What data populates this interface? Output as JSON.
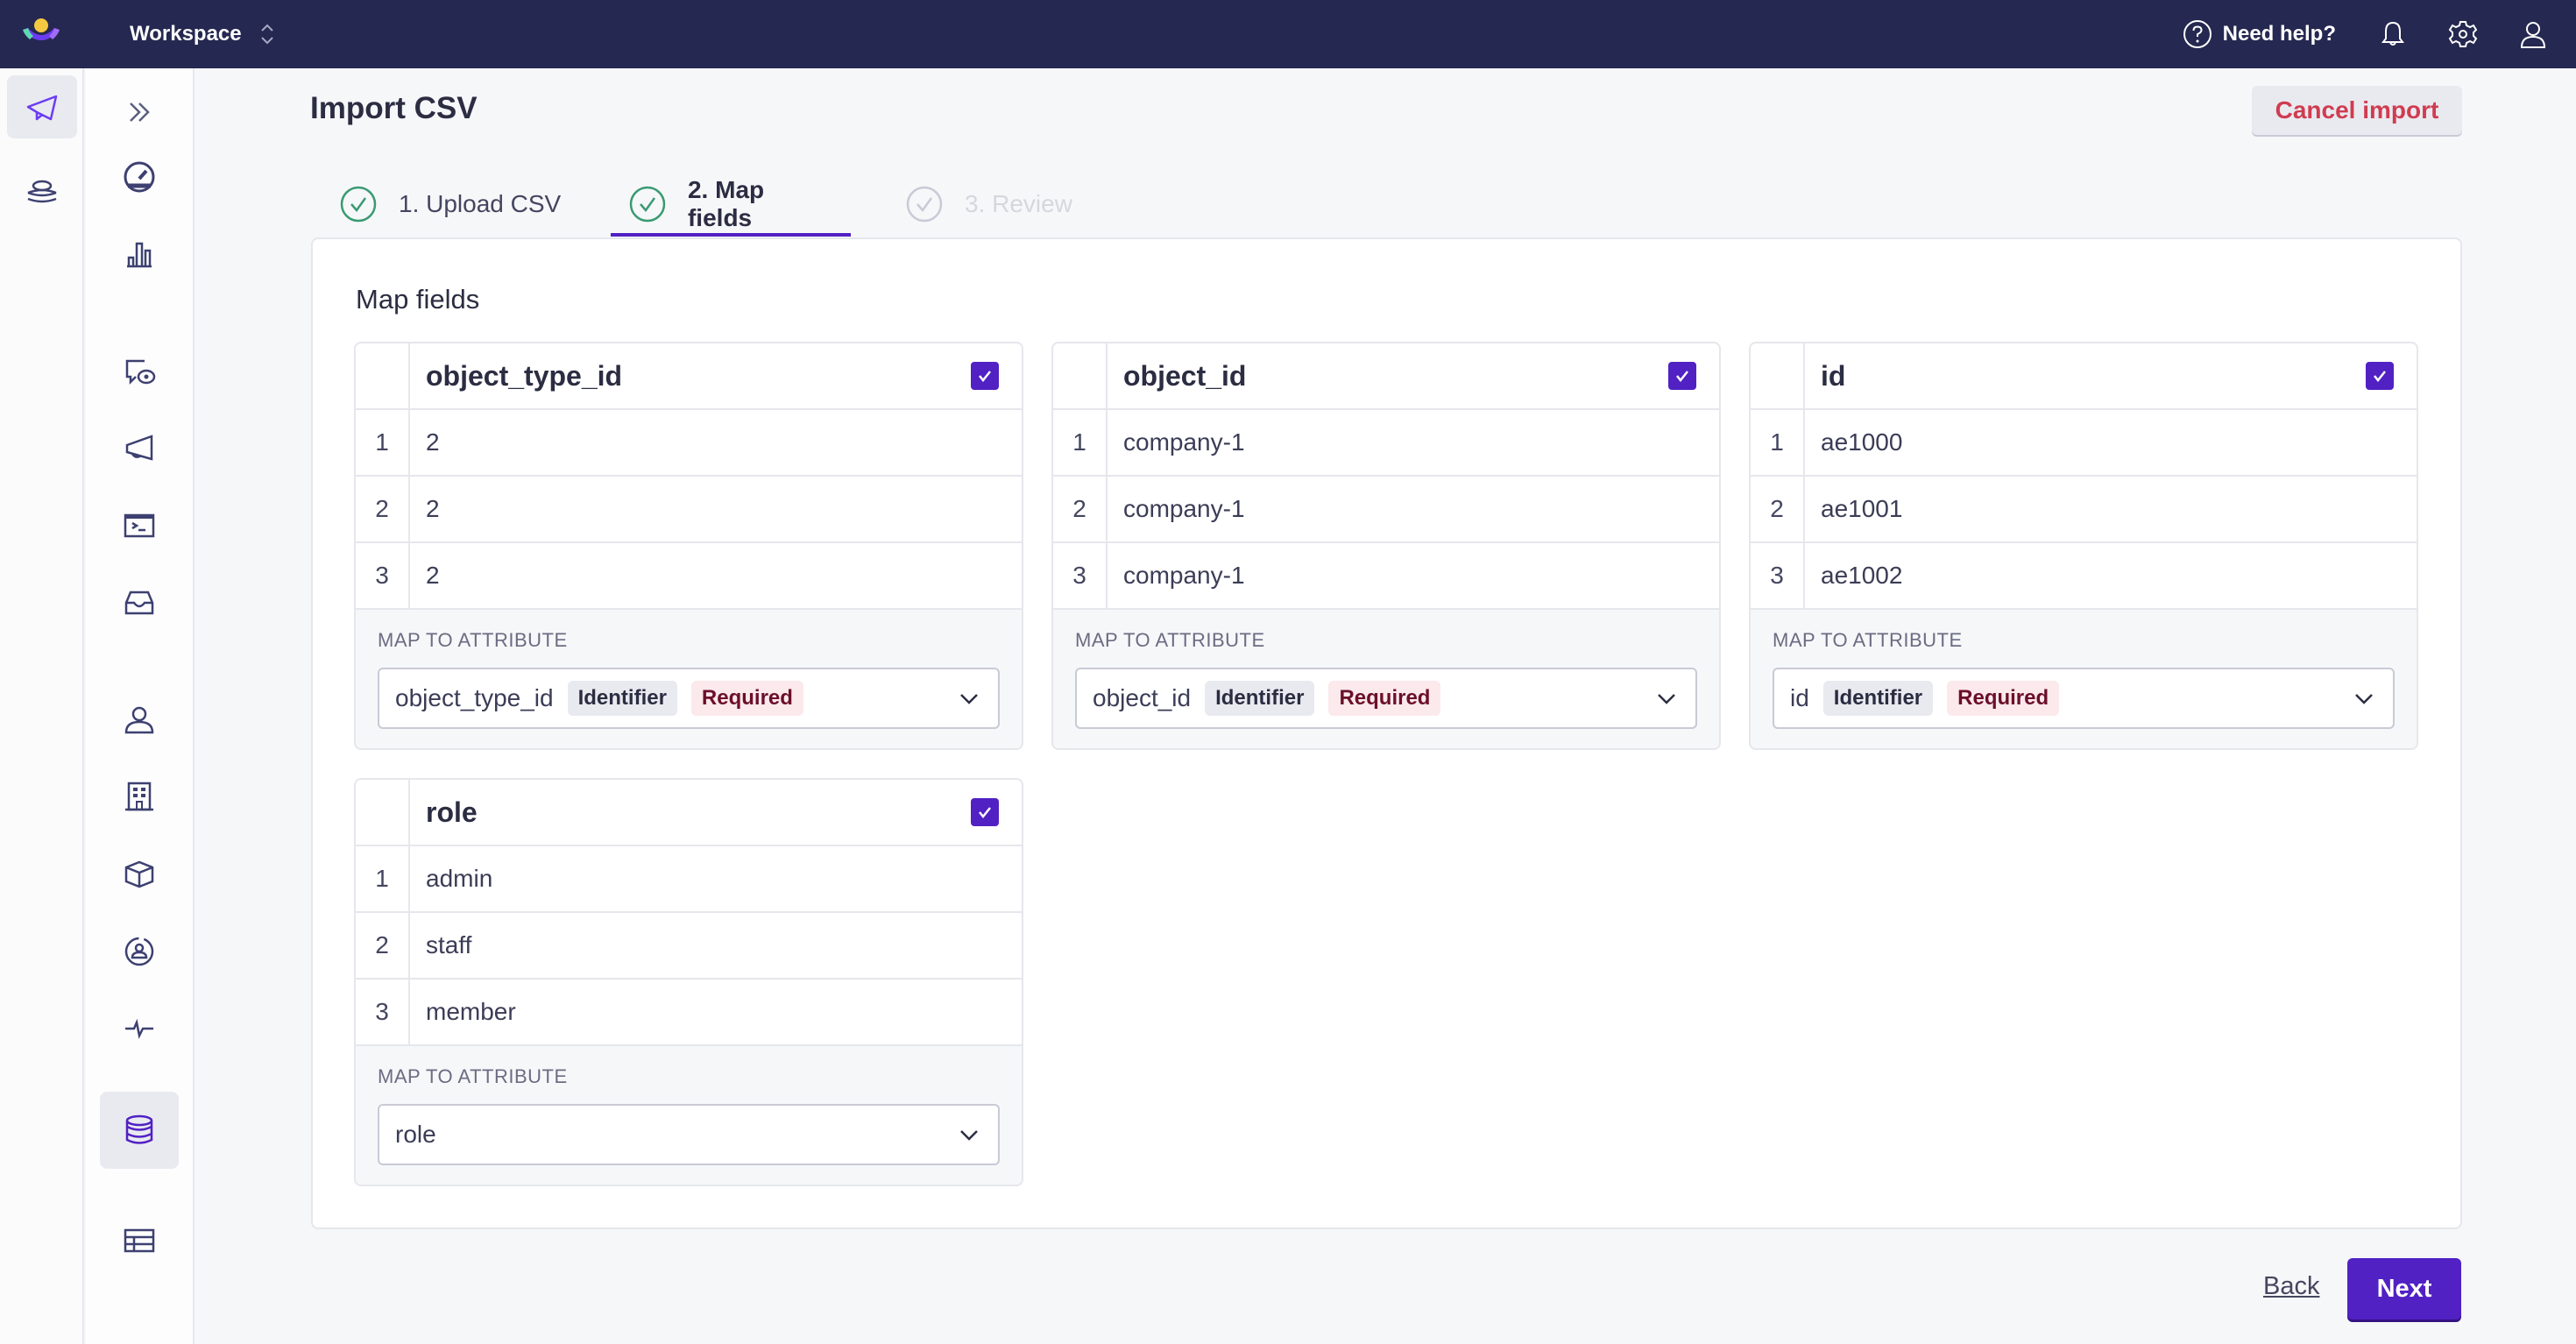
{
  "topbar": {
    "workspace_label": "Workspace",
    "help_label": "Need help?"
  },
  "colors": {
    "topbar_bg": "#252850",
    "accent": "#5121c4",
    "success": "#3a9a72",
    "danger": "#d03c50"
  },
  "page": {
    "title": "Import CSV",
    "cancel_label": "Cancel import"
  },
  "steps": [
    {
      "label": "1. Upload CSV",
      "state": "complete"
    },
    {
      "label": "2. Map fields",
      "state": "active"
    },
    {
      "label": "3. Review",
      "state": "disabled"
    }
  ],
  "card": {
    "title": "Map fields",
    "map_label": "MAP TO ATTRIBUTE",
    "columns": [
      {
        "name": "object_type_id",
        "checked": true,
        "rows": [
          {
            "n": "1",
            "v": "2"
          },
          {
            "n": "2",
            "v": "2"
          },
          {
            "n": "3",
            "v": "2"
          }
        ],
        "attribute": "object_type_id",
        "badges": [
          "Identifier",
          "Required"
        ]
      },
      {
        "name": "object_id",
        "checked": true,
        "rows": [
          {
            "n": "1",
            "v": "company-1"
          },
          {
            "n": "2",
            "v": "company-1"
          },
          {
            "n": "3",
            "v": "company-1"
          }
        ],
        "attribute": "object_id",
        "badges": [
          "Identifier",
          "Required"
        ]
      },
      {
        "name": "id",
        "checked": true,
        "rows": [
          {
            "n": "1",
            "v": "ae1000"
          },
          {
            "n": "2",
            "v": "ae1001"
          },
          {
            "n": "3",
            "v": "ae1002"
          }
        ],
        "attribute": "id",
        "badges": [
          "Identifier",
          "Required"
        ]
      },
      {
        "name": "role",
        "checked": true,
        "rows": [
          {
            "n": "1",
            "v": "admin"
          },
          {
            "n": "2",
            "v": "staff"
          },
          {
            "n": "3",
            "v": "member"
          }
        ],
        "attribute": "role",
        "badges": []
      }
    ]
  },
  "footer": {
    "back_label": "Back",
    "next_label": "Next"
  },
  "rail_icons": [
    "paper-plane-icon",
    "layers-icon"
  ],
  "nav_icons": [
    "expand-icon",
    "dashboard-gauge-icon",
    "bar-chart-icon",
    "chat-preview-icon",
    "megaphone-icon",
    "terminal-icon",
    "inbox-icon",
    "person-icon",
    "building-icon",
    "box-icon",
    "user-circle-icon",
    "activity-icon",
    "database-icon",
    "table-icon"
  ]
}
